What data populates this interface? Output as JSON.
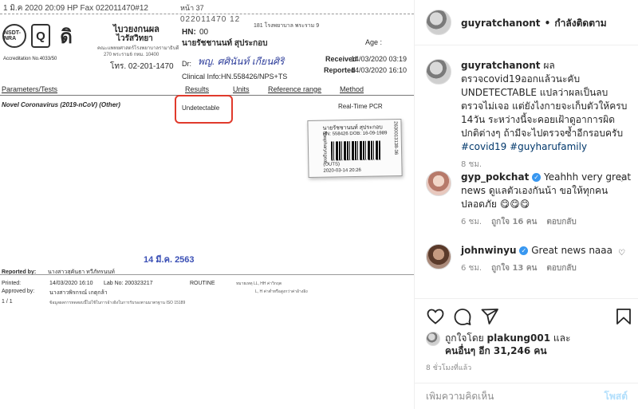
{
  "report": {
    "fax_header": "1 มิ.ค 2020 20:09 HP Fax 022011470#12",
    "page_no": "หน้า 37",
    "stamp_no": "022011470 12",
    "logo_labels": [
      "NSDT-NRA",
      "Q",
      "ดิ"
    ],
    "lab_name": "ไบวยงกนผล",
    "lab_name2": "ไวรัสวิทยา",
    "lab_address1": "คณะแพทยศาสตร์โรงพยาบาลรามาธิบดี",
    "lab_address2": "270 พระราม6 กทม. 10400",
    "accreditation": "Accreditation No.4033/50",
    "tel": "โทร. 02-201-1470",
    "hn_label": "HN:",
    "hn_value": "00",
    "patient_address": "181 โรงพยาบาล พระราม 9",
    "age_label": "Age :",
    "patient_name": "นายรัชชานนท์ สุประกอบ",
    "dr_label": "Dr:",
    "dr_sign": "พญ. ศศินันท์ เกียนศิริ",
    "received_label": "Received",
    "received_value": "14/03/2020 03:19",
    "reported_label": "Reported",
    "reported_value": "14/03/2020 16:10",
    "clinical_info": "Clinical Info:HN.558426/NPS+TS",
    "headers": {
      "parameters": "Parameters/Tests",
      "results": "Results",
      "units": "Units",
      "reference": "Reference range",
      "method": "Method"
    },
    "test_name": "Novel Coronavirus (2019-nCoV) (Other)",
    "result_value": "Undetectable",
    "method_value": "Real-Time PCR",
    "sticker": {
      "name": "นายรัชชานนท์ สุประกอบ",
      "hn_line": "HN: 558426  DOB: 16-09-1989",
      "outs": "(OUTS)",
      "datetime": "2020-03-14 20:26",
      "side": "Naspharyngeal",
      "right": "2630013138-36"
    },
    "date_stamp": "14 มี.ค. 2563",
    "reported_by_label": "Reported by:",
    "reported_by_value": "นางสาวสุคันธา ทวีภัทรนนท์",
    "printed_label": "Printed:",
    "printed_value": "14/03/2020 16:10",
    "lab_no": "Lab No: 200323217",
    "routine": "ROUTINE",
    "approved_label": "Approved by:",
    "approved_value": "นางสาวพิรกรณ์ เกตุกล้า",
    "page_of": "1 / 1",
    "footer": "ข้อมูลผลการทดสอบนี้ไม่ใช้ในการอ้างอิงในการรับรองตามมาตรฐาน ISO 15189",
    "right_note1": "หมายเหตุ LL, HH ค่าวิกฤต",
    "right_note2": "L, H ค่าต่ำหรือสูงกว่าค่าอ้างอิง"
  },
  "post": {
    "username": "guyratchanont",
    "separator": "•",
    "follow_label": "กำลังติดตาม",
    "caption": {
      "username": "guyratchanont",
      "text": "ผลตรวจcovid19ออกแล้วนะคับ UNDETECTABLE แปลว่าผลเป็นลบ ตรวจไม่เจอ แต่ยังไงกายจะเก็บตัวให้ครบ 14วัน ระหว่างนี้จะคอยเฝ้าดูอาการผิดปกติต่างๆ ถ้ามีจะไปตรวจซ้ำอีกรอบครับ",
      "hashtags": "#covid19 #guyharufamily",
      "time": "8 ชม."
    },
    "comments": [
      {
        "username": "gyp_pokchat",
        "text": "Yeahhh very great news ดูแลตัวเองกันน้า ขอให้ทุกคนปลอดภัย 😋😋😋",
        "time": "6 ชม.",
        "likes": "ถูกใจ 16 คน",
        "reply": "ตอบกลับ"
      },
      {
        "username": "johnwinyu",
        "text": "Great news naaa",
        "time": "6 ชม.",
        "likes": "ถูกใจ 13 คน",
        "reply": "ตอบกลับ"
      }
    ],
    "liked_by_prefix": "ถูกใจโดย",
    "liked_by_user": "plakung001",
    "liked_by_and": "และ",
    "liked_by_others": "คนอื่นๆ อีก 31,246 คน",
    "post_time": "8 ชั่วโมงที่แล้ว",
    "add_comment_placeholder": "เพิ่มความคิดเห็น",
    "post_button": "โพสต์",
    "icons": [
      "heart-icon",
      "comment-icon",
      "share-icon",
      "bookmark-icon",
      "verified-icon"
    ],
    "colors": {
      "link": "#00376b",
      "verified": "#3897f0",
      "muted": "#8e8e8e",
      "post_button": "#b2dffc"
    }
  }
}
